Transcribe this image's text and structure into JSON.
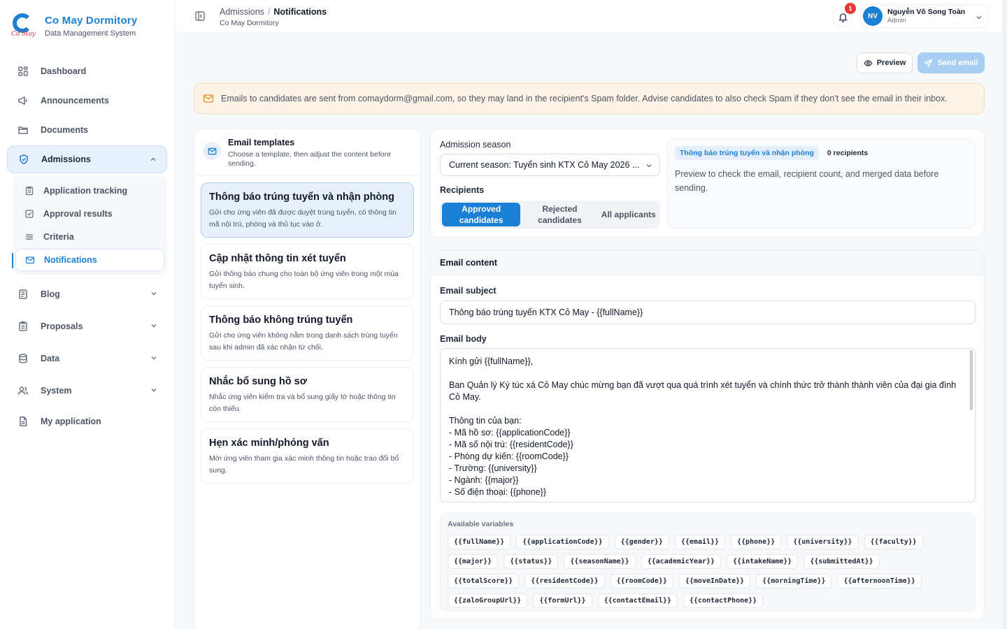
{
  "brand": {
    "title": "Co May Dormitory",
    "subtitle": "Data Management System",
    "logo_script": "Cỏ May",
    "accent": "#1c7fd6"
  },
  "sidebar": {
    "items": [
      {
        "label": "Dashboard",
        "icon": "grid-icon"
      },
      {
        "label": "Announcements",
        "icon": "megaphone-icon"
      },
      {
        "label": "Documents",
        "icon": "folder-icon"
      },
      {
        "label": "Admissions",
        "icon": "shield-icon",
        "active": true,
        "expanded": true
      },
      {
        "label": "Blog",
        "icon": "blog-icon"
      },
      {
        "label": "Proposals",
        "icon": "clipboard-icon"
      },
      {
        "label": "Data",
        "icon": "database-icon"
      },
      {
        "label": "System",
        "icon": "users-icon"
      },
      {
        "label": "My application",
        "icon": "file-icon"
      }
    ],
    "admissions_sub": [
      {
        "label": "Application tracking",
        "icon": "clipboard-icon"
      },
      {
        "label": "Approval results",
        "icon": "check-square-icon"
      },
      {
        "label": "Criteria",
        "icon": "sliders-icon"
      },
      {
        "label": "Notifications",
        "icon": "mail-icon",
        "active": true
      }
    ]
  },
  "header": {
    "breadcrumb_parent": "Admissions",
    "breadcrumb_sep": "/",
    "breadcrumb_current": "Notifications",
    "breadcrumb_sub": "Co May Dormitory",
    "notification_count": "1",
    "user_initials": "NV",
    "user_name": "Nguyễn Võ Song Toàn",
    "user_role": "Admin"
  },
  "actions": {
    "preview_label": "Preview",
    "send_label": "Send email"
  },
  "notice": "Emails to candidates are sent from comaydorm@gmail.com, so they may land in the recipient's Spam folder. Advise candidates to also check Spam if they don't see the email in their inbox.",
  "templates": {
    "title": "Email templates",
    "description": "Choose a template, then adjust the content before sending.",
    "items": [
      {
        "title": "Thông báo trúng tuyển và nhận phòng",
        "desc": "Gửi cho ứng viên đã được duyệt trúng tuyển, có thông tin mã nội trú, phòng và thủ tục vào ở.",
        "active": true
      },
      {
        "title": "Cập nhật thông tin xét tuyển",
        "desc": "Gửi thông báo chung cho toàn bộ ứng viên trong một mùa tuyển sinh."
      },
      {
        "title": "Thông báo không trúng tuyển",
        "desc": "Gửi cho ứng viên không nằm trong danh sách trúng tuyển sau khi admin đã xác nhận từ chối."
      },
      {
        "title": "Nhắc bổ sung hồ sơ",
        "desc": "Nhắc ứng viên kiểm tra và bổ sung giấy tờ hoặc thông tin còn thiếu."
      },
      {
        "title": "Hẹn xác minh/phỏng vấn",
        "desc": "Mời ứng viên tham gia xác minh thông tin hoặc trao đổi bổ sung."
      }
    ]
  },
  "season": {
    "label": "Admission season",
    "selected": "Current season: Tuyển sinh KTX Cỏ May 2026 ...",
    "recipients_label": "Recipients",
    "recipient_options": [
      {
        "label": "Approved candidates",
        "active": true
      },
      {
        "label": "Rejected candidates"
      },
      {
        "label": "All applicants"
      }
    ],
    "preview_chip": "Thông báo trúng tuyển và nhận phòng",
    "recipient_count": "0 recipients",
    "preview_text": "Preview to check the email, recipient count, and merged data before sending."
  },
  "content": {
    "title": "Email content",
    "subject_label": "Email subject",
    "subject_value": "Thông báo trúng tuyển KTX Cỏ May - {{fullName}}",
    "body_label": "Email body",
    "body_lines": [
      "Kính gửi {{fullName}},",
      "",
      "Ban Quản lý Ký túc xá Cỏ May chúc mừng bạn đã vượt qua quá trình xét tuyển và chính thức trở thành thành viên của đại gia đình Cỏ May.",
      "",
      "Thông tin của bạn:",
      "- Mã hồ sơ: {{applicationCode}}",
      "- Mã số nội trú: {{residentCode}}",
      "- Phòng dự kiến: {{roomCode}}",
      "- Trường: {{university}}",
      "- Ngành: {{major}}",
      "- Số điện thoại: {{phone}}"
    ],
    "vars_title": "Available variables",
    "variables": [
      "{{fullName}}",
      "{{applicationCode}}",
      "{{gender}}",
      "{{email}}",
      "{{phone}}",
      "{{university}}",
      "{{faculty}}",
      "{{major}}",
      "{{status}}",
      "{{seasonName}}",
      "{{academicYear}}",
      "{{intakeName}}",
      "{{submittedAt}}",
      "{{totalScore}}",
      "{{residentCode}}",
      "{{roomCode}}",
      "{{moveInDate}}",
      "{{morningTime}}",
      "{{afternoonTime}}",
      "{{zaloGroupUrl}}",
      "{{formUrl}}",
      "{{contactEmail}}",
      "{{contactPhone}}"
    ]
  }
}
